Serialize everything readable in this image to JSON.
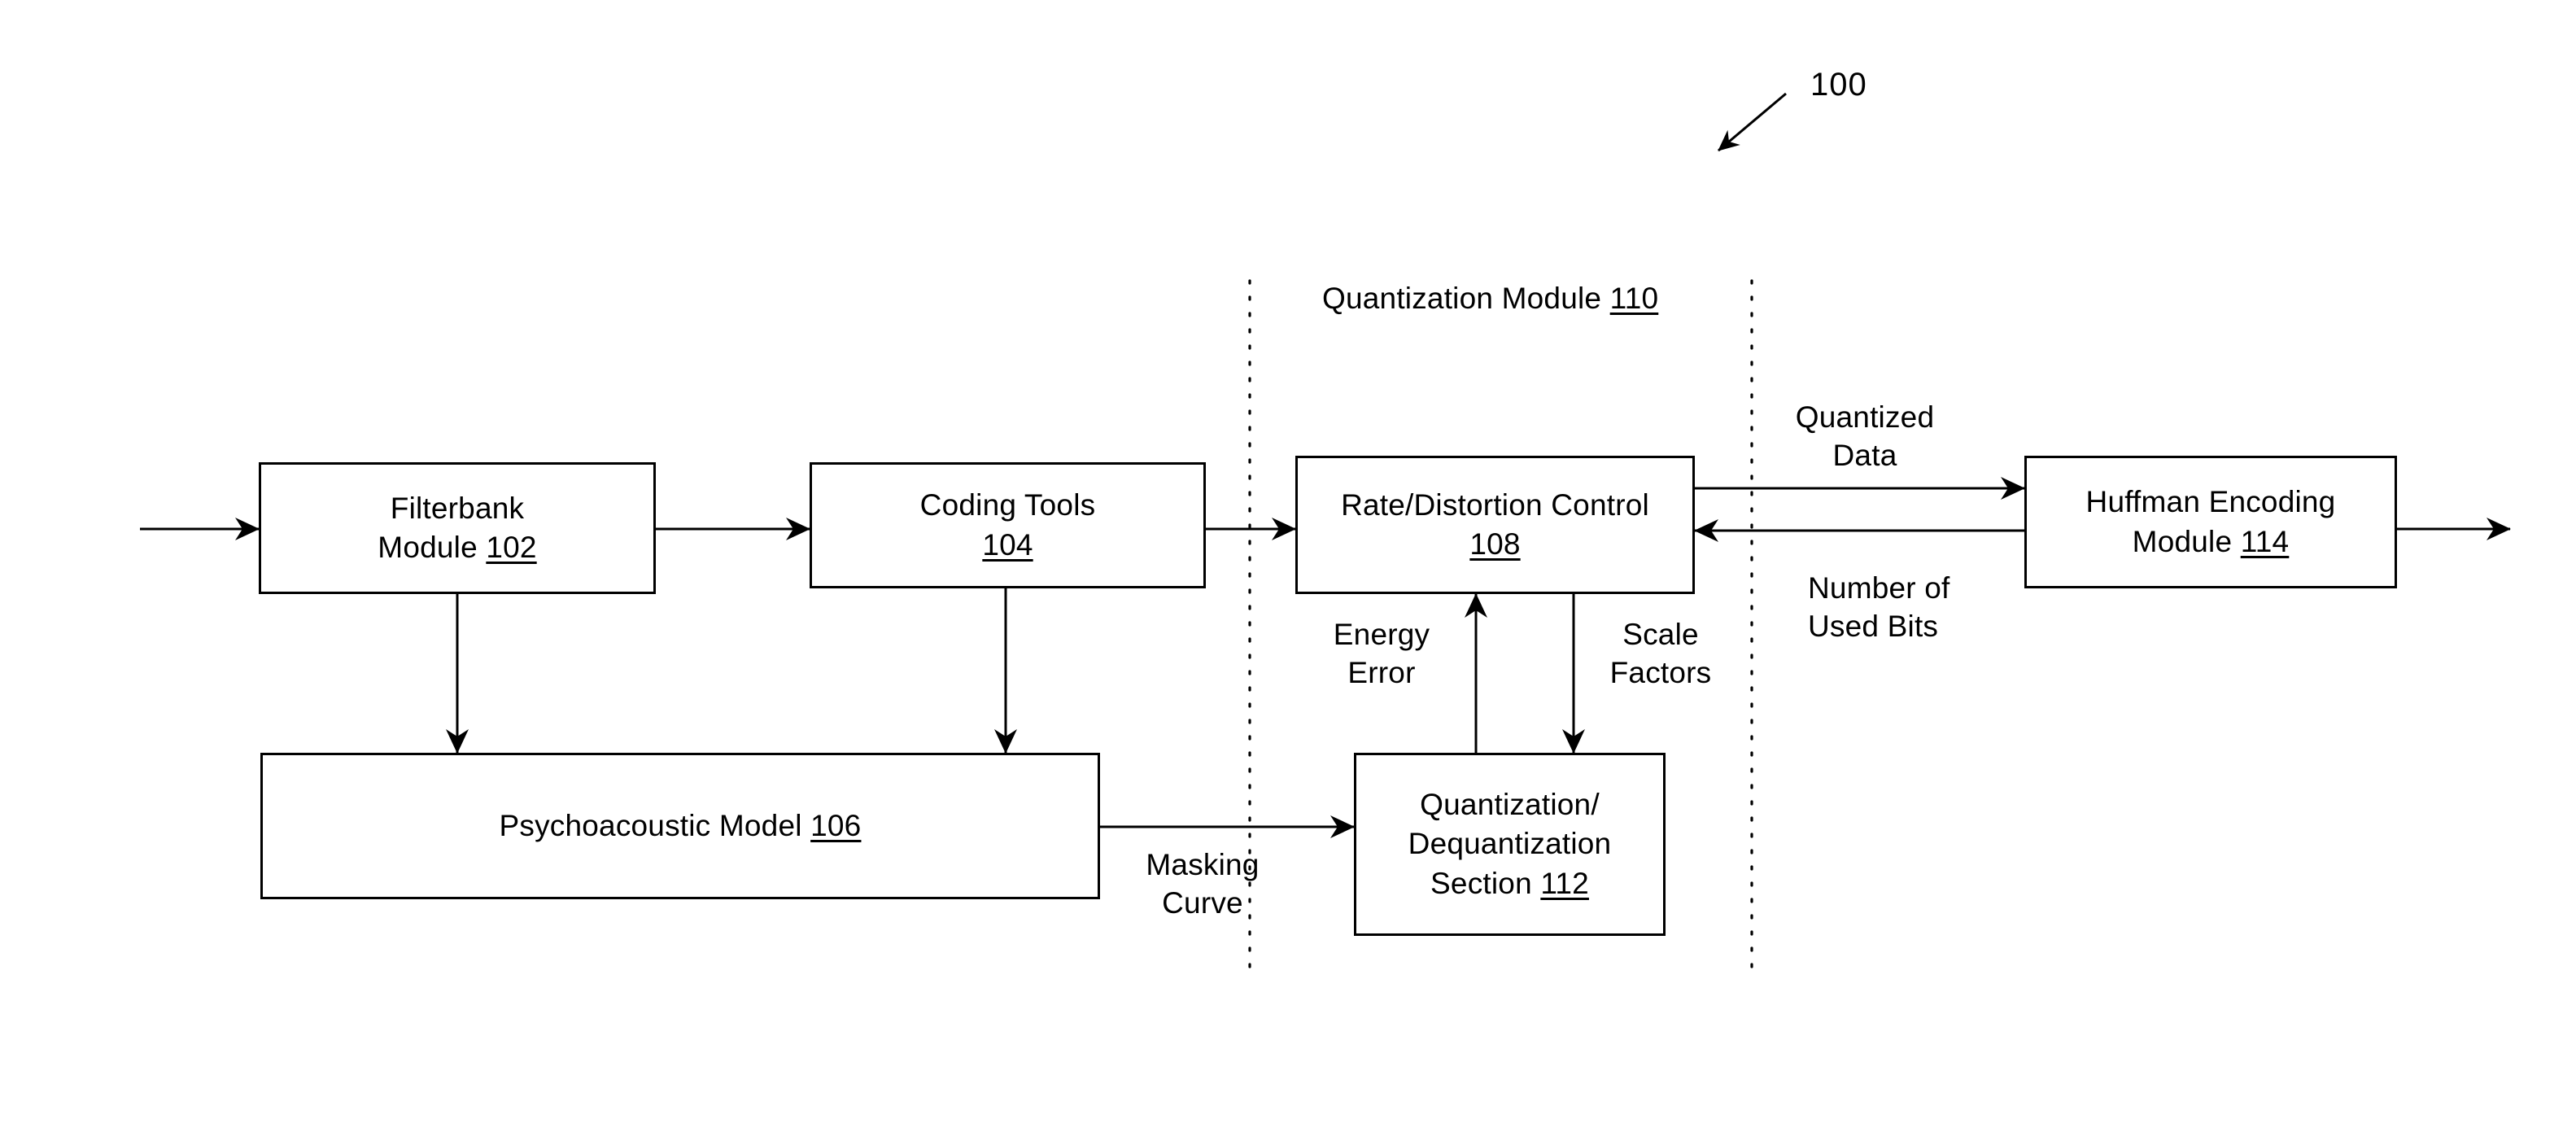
{
  "figure": {
    "reference_numeral": "100",
    "pointer_icon": "diagonal-leader-arrow"
  },
  "group_label": {
    "text_prefix": "Quantization Module ",
    "reference": "110",
    "full_text": "Quantization Module 110"
  },
  "blocks": [
    {
      "id": "filterbank-module",
      "lines": [
        "Filterbank",
        "Module "
      ],
      "line1": "Filterbank",
      "line2_prefix": "Module ",
      "reference": "102"
    },
    {
      "id": "coding-tools",
      "line1": "Coding Tools",
      "line2_prefix": "",
      "reference": "104"
    },
    {
      "id": "rate-distortion-control",
      "line1": "Rate/Distortion Control",
      "line2_prefix": "",
      "reference": "108"
    },
    {
      "id": "huffman-encoding-module",
      "line1": "Huffman Encoding",
      "line2_prefix": "Module ",
      "reference": "114"
    },
    {
      "id": "psychoacoustic-model",
      "line1_prefix": "Psychoacoustic Model ",
      "reference": "106"
    },
    {
      "id": "quantization-dequantization-section",
      "line1": "Quantization/",
      "line2": "Dequantization",
      "line3_prefix": "Section ",
      "reference": "112"
    }
  ],
  "edge_labels": {
    "quantized_data_l1": "Quantized",
    "quantized_data_l2": "Data",
    "number_of_used_bits_l1": "Number of",
    "number_of_used_bits_l2": "Used Bits",
    "energy_error_l1": "Energy",
    "energy_error_l2": "Error",
    "scale_factors_l1": "Scale",
    "scale_factors_l2": "Factors",
    "masking_curve_l1": "Masking",
    "masking_curve_l2": "Curve"
  },
  "style": {
    "line_color": "#000000",
    "background": "#ffffff",
    "stroke_width": 3
  }
}
